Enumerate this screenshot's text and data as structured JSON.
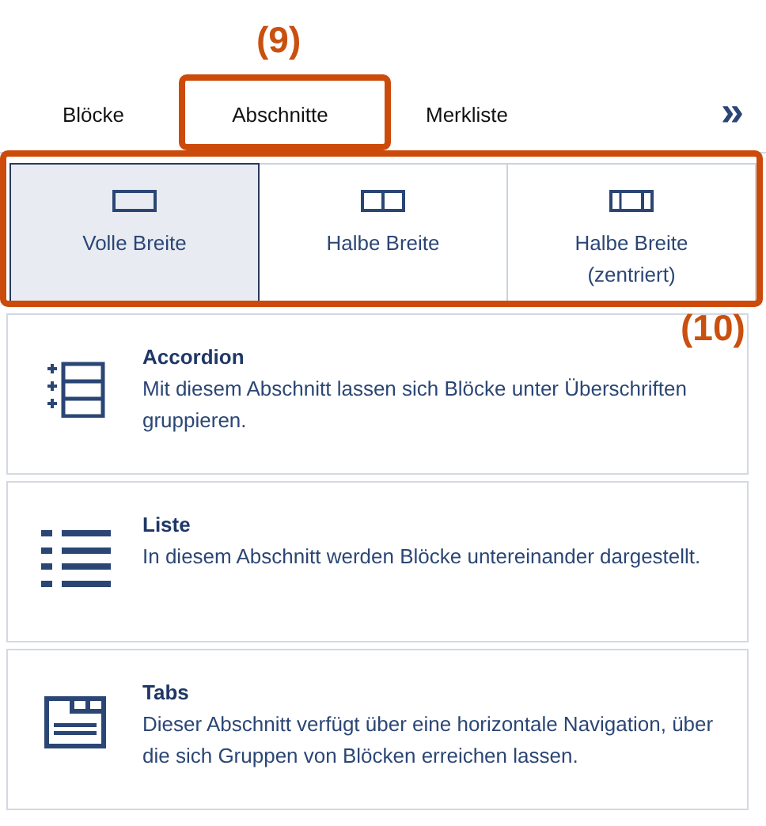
{
  "tabs": [
    {
      "label": "Blöcke"
    },
    {
      "label": "Abschnitte"
    },
    {
      "label": "Merkliste"
    }
  ],
  "more_tabs": "»",
  "layout_options": [
    {
      "kind": "full",
      "label": "Volle Breite",
      "selected": true
    },
    {
      "kind": "half",
      "label": "Halbe Breite",
      "selected": false
    },
    {
      "kind": "half-centered",
      "label": "Halbe Breite (zentriert)",
      "selected": false
    }
  ],
  "sections": [
    {
      "kind": "accordion",
      "title": "Accordion",
      "description": "Mit diesem Abschnitt lassen sich Blöcke unter Überschriften gruppieren."
    },
    {
      "kind": "list",
      "title": "Liste",
      "description": "In diesem Abschnitt werden Blöcke untereinander dargestellt."
    },
    {
      "kind": "tabs",
      "title": "Tabs",
      "description": "Dieser Abschnitt verfügt über eine horizontale Navigation, über die sich Gruppen von Blöcken erreichen lassen."
    }
  ],
  "callouts": [
    {
      "label": "(9)"
    },
    {
      "label": "(10)"
    }
  ]
}
